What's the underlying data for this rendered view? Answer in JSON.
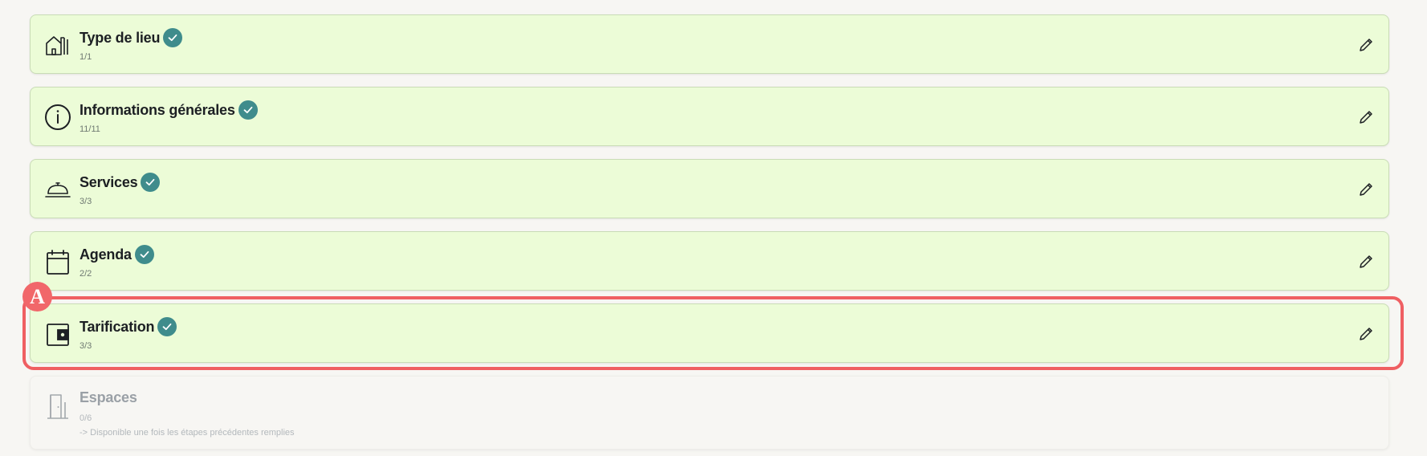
{
  "steps": [
    {
      "title": "Type de lieu",
      "count": "1/1",
      "icon": "house-icon",
      "completed": true
    },
    {
      "title": "Informations générales",
      "count": "11/11",
      "icon": "info-icon",
      "completed": true
    },
    {
      "title": "Services",
      "count": "3/3",
      "icon": "cloche-icon",
      "completed": true
    },
    {
      "title": "Agenda",
      "count": "2/2",
      "icon": "calendar-icon",
      "completed": true
    },
    {
      "title": "Tarification",
      "count": "3/3",
      "icon": "wallet-icon",
      "completed": true
    },
    {
      "title": "Espaces",
      "count": "0/6",
      "icon": "door-icon",
      "completed": false,
      "hint": "-> Disponible une fois les étapes précédentes remplies"
    }
  ],
  "annotation": {
    "label": "A",
    "color": "#ef5f62"
  },
  "colors": {
    "card_bg": "#ecfcd7",
    "check_bg": "#3f8c8c",
    "page_bg": "#f7f6f3"
  }
}
